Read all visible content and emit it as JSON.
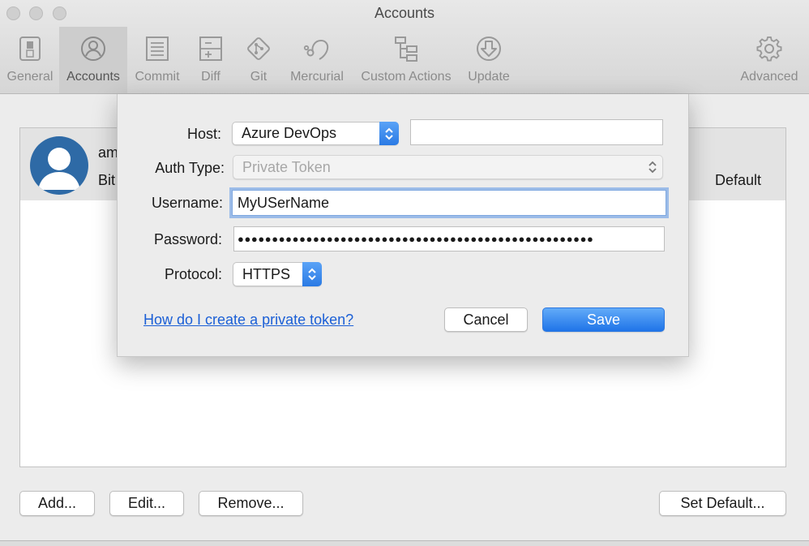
{
  "window": {
    "title": "Accounts"
  },
  "toolbar": {
    "items": [
      {
        "label": "General",
        "icon": "toggle-switch-icon"
      },
      {
        "label": "Accounts",
        "icon": "user-circle-icon",
        "active": true
      },
      {
        "label": "Commit",
        "icon": "document-lines-icon"
      },
      {
        "label": "Diff",
        "icon": "diff-icon"
      },
      {
        "label": "Git",
        "icon": "git-icon"
      },
      {
        "label": "Mercurial",
        "icon": "mercurial-icon"
      },
      {
        "label": "Custom Actions",
        "icon": "hierarchy-icon"
      },
      {
        "label": "Update",
        "icon": "download-circle-icon"
      },
      {
        "label": "Advanced",
        "icon": "gear-icon"
      }
    ]
  },
  "accounts": {
    "rows": [
      {
        "name": "am",
        "host": "Bit",
        "status": "Default"
      }
    ]
  },
  "bottom_buttons": {
    "add": "Add...",
    "edit": "Edit...",
    "remove": "Remove...",
    "set_default": "Set Default..."
  },
  "dialog": {
    "host_label": "Host:",
    "host_value": "Azure DevOps",
    "host_url": "",
    "auth_type_label": "Auth Type:",
    "auth_type_value": "Private Token",
    "username_label": "Username:",
    "username_value": "MyUSerName",
    "password_label": "Password:",
    "password_value": "●●●●●●●●●●●●●●●●●●●●●●●●●●●●●●●●●●●●●●●●●●●●●●●●●●●●",
    "protocol_label": "Protocol:",
    "protocol_value": "HTTPS",
    "help_link": "How do I create a private token?",
    "cancel": "Cancel",
    "save": "Save"
  },
  "colors": {
    "accent": "#2a7ae4",
    "link": "#1b5fd6",
    "avatar": "#2e6aa6"
  }
}
